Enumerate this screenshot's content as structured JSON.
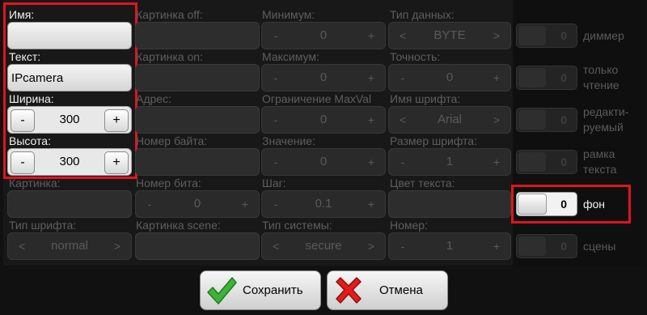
{
  "labels": {
    "name": "Имя:",
    "text": "Текст:",
    "width": "Ширина:",
    "height": "Высота:",
    "picture_off": "Картинка off:",
    "picture_on": "Картинка on:",
    "address": "Адрес:",
    "byte_number": "Номер байта:",
    "bit_number": "Номер бита:",
    "picture_scene": "Картинка scene:",
    "minimum": "Минимум:",
    "maximum": "Максимум:",
    "limit_maxval": "Ограничение MaxVal",
    "value": "Значение:",
    "step": "Шаг:",
    "system_type": "Тип системы:",
    "data_type": "Тип данных:",
    "precision": "Точность:",
    "font_name": "Имя шрифта:",
    "font_size": "Размер шрифта:",
    "text_color": "Цвет текста:",
    "number": "Номер:",
    "picture": "Картинка:",
    "font_type": "Тип шрифта:"
  },
  "fields": {
    "name_value": "",
    "text_value": "IPcamera"
  },
  "spinners": {
    "width": {
      "minus": "-",
      "value": "300",
      "plus": "+"
    },
    "height": {
      "minus": "-",
      "value": "300",
      "plus": "+"
    },
    "minimum": {
      "minus": "-",
      "value": "0",
      "plus": "+"
    },
    "maximum": {
      "minus": "-",
      "value": "0",
      "plus": "+"
    },
    "limit_maxval": {
      "minus": "-",
      "value": "0",
      "plus": "+"
    },
    "value": {
      "minus": "-",
      "value": "0",
      "plus": "+"
    },
    "step": {
      "minus": "-",
      "value": "0.1",
      "plus": "+"
    },
    "system_type": {
      "minus": "<",
      "value": "secure",
      "plus": ">"
    },
    "data_type": {
      "minus": "<",
      "value": "BYTE",
      "plus": ">"
    },
    "precision": {
      "minus": "-",
      "value": "0",
      "plus": "+"
    },
    "font_name": {
      "minus": "<",
      "value": "Arial",
      "plus": ">"
    },
    "font_size": {
      "minus": "-",
      "value": "1",
      "plus": "+"
    },
    "number": {
      "minus": "-",
      "value": "1",
      "plus": "+"
    },
    "bit_number": {
      "minus": "-",
      "value": "0",
      "plus": "+"
    },
    "font_type": {
      "minus": "<",
      "value": "normal",
      "plus": ">"
    }
  },
  "toggles": {
    "dimmer": {
      "value": "0",
      "label": "диммер"
    },
    "readonly": {
      "value": "0",
      "label_1": "только",
      "label_2": "чтение"
    },
    "editable": {
      "value": "0",
      "label_1": "редакти-",
      "label_2": "руемый"
    },
    "text_frame": {
      "value": "0",
      "label_1": "рамка",
      "label_2": "текста"
    },
    "background": {
      "value": "0",
      "label": "фон"
    },
    "scenes": {
      "value": "0",
      "label": "сцены"
    }
  },
  "buttons": {
    "save": "Сохранить",
    "cancel": "Отмена"
  },
  "colors": {
    "highlight": "#e0141c",
    "save_icon": "#3db33a",
    "cancel_icon": "#e41b1b"
  }
}
